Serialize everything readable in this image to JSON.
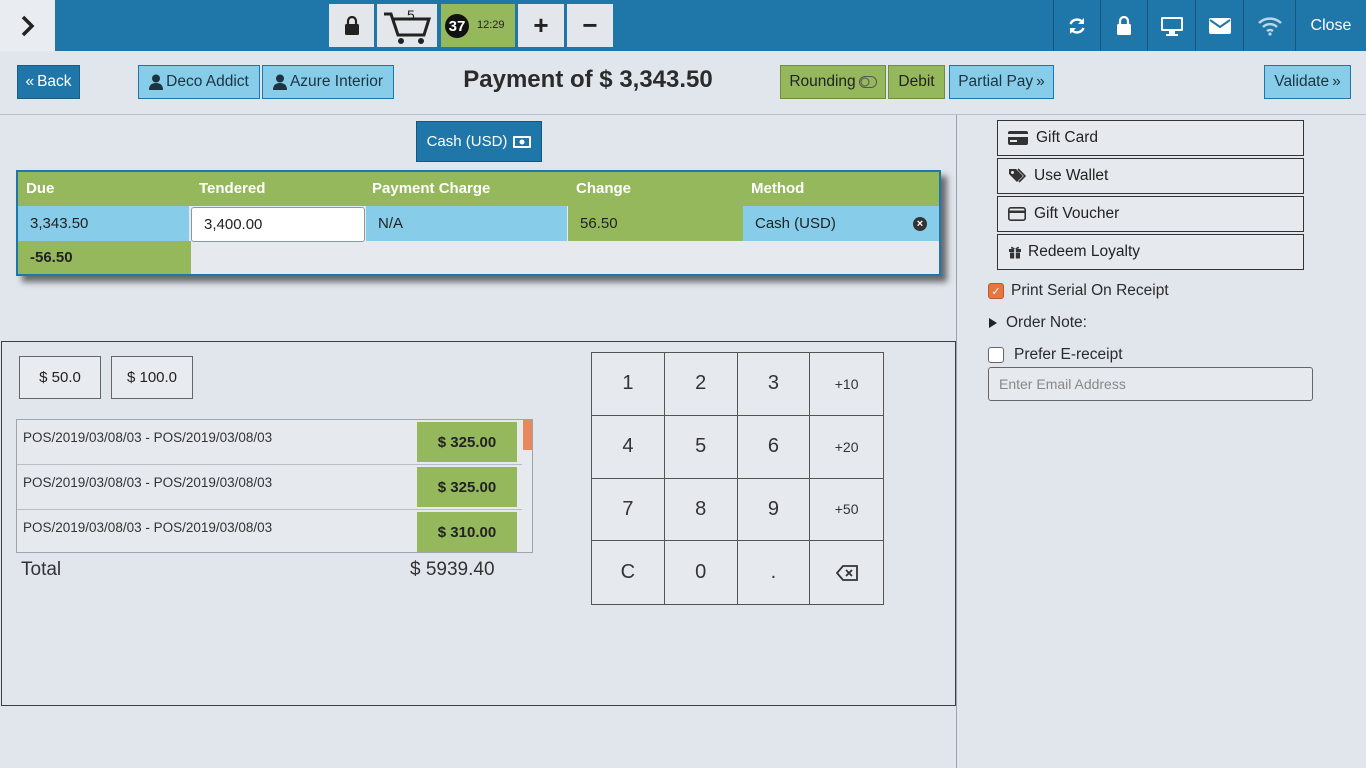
{
  "topbar": {
    "cart_count": "5",
    "order_number": "37",
    "order_time": "12:29",
    "plus_label": "+",
    "minus_label": "−",
    "close_label": "Close"
  },
  "header": {
    "back_label": "Back",
    "customer_1": "Deco Addict",
    "customer_2": "Azure Interior",
    "title": "Payment of $ 3,343.50",
    "rounding_label": "Rounding",
    "debit_label": "Debit",
    "partial_pay_label": "Partial Pay",
    "validate_label": "Validate"
  },
  "payment_method_tab": "Cash (USD)",
  "payment_table": {
    "columns": [
      "Due",
      "Tendered",
      "Payment Charge",
      "Change",
      "Method"
    ],
    "row": {
      "due": "3,343.50",
      "tendered": "3,400.00",
      "payment_charge": "N/A",
      "change": "56.50",
      "method": "Cash (USD)"
    },
    "remaining": "-56.50"
  },
  "quick_amounts": [
    "$ 50.0",
    "$ 100.0"
  ],
  "invoices": [
    {
      "label": "POS/2019/03/08/03 - POS/2019/03/08/03",
      "amount": "$ 325.00"
    },
    {
      "label": "POS/2019/03/08/03 - POS/2019/03/08/03",
      "amount": "$ 325.00"
    },
    {
      "label": "POS/2019/03/08/03 - POS/2019/03/08/03",
      "amount": "$ 310.00"
    }
  ],
  "total": {
    "label": "Total",
    "value": "$ 5939.40"
  },
  "numpad": {
    "keys": [
      "1",
      "2",
      "3",
      "+10",
      "4",
      "5",
      "6",
      "+20",
      "7",
      "8",
      "9",
      "+50",
      "C",
      "0",
      "."
    ]
  },
  "side_options": {
    "gift_card": "Gift Card",
    "use_wallet": "Use Wallet",
    "gift_voucher": "Gift Voucher",
    "redeem_loyalty": "Redeem Loyalty",
    "print_serial": "Print Serial On Receipt",
    "print_serial_checked": true,
    "order_note": "Order Note:",
    "prefer_ereceipt": "Prefer E-receipt",
    "prefer_ereceipt_checked": false,
    "email_placeholder": "Enter Email Address"
  },
  "colors": {
    "topbar": "#1f76a8",
    "accent_light": "#87cdea",
    "green": "#96b85d",
    "scroll_thumb": "#e8885f"
  }
}
